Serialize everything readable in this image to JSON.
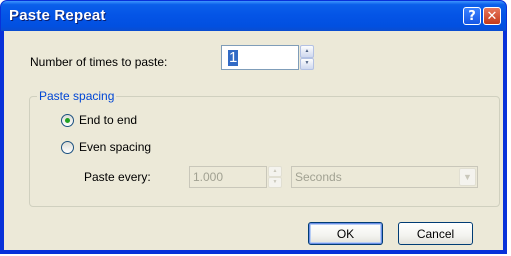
{
  "dialog": {
    "title": "Paste Repeat",
    "help_glyph": "?",
    "close_glyph": "✕"
  },
  "times": {
    "label": "Number of times to paste:",
    "value": "1"
  },
  "spacing": {
    "group_title": "Paste spacing",
    "end_to_end_label": "End to end",
    "even_spacing_label": "Even spacing",
    "selected": "End to end",
    "paste_every_label": "Paste every:",
    "paste_every_value": "1.000",
    "unit_value": "Seconds"
  },
  "buttons": {
    "ok": "OK",
    "cancel": "Cancel"
  },
  "colors": {
    "titlebar": "#0454e6",
    "face": "#ece9d8",
    "group_title": "#0046d5",
    "radio_dot": "#21a121"
  },
  "icons": {
    "help": "help-icon",
    "close": "close-icon",
    "spin_up": "up-arrow-icon",
    "spin_down": "down-arrow-icon",
    "dropdown": "chevron-down-icon"
  }
}
